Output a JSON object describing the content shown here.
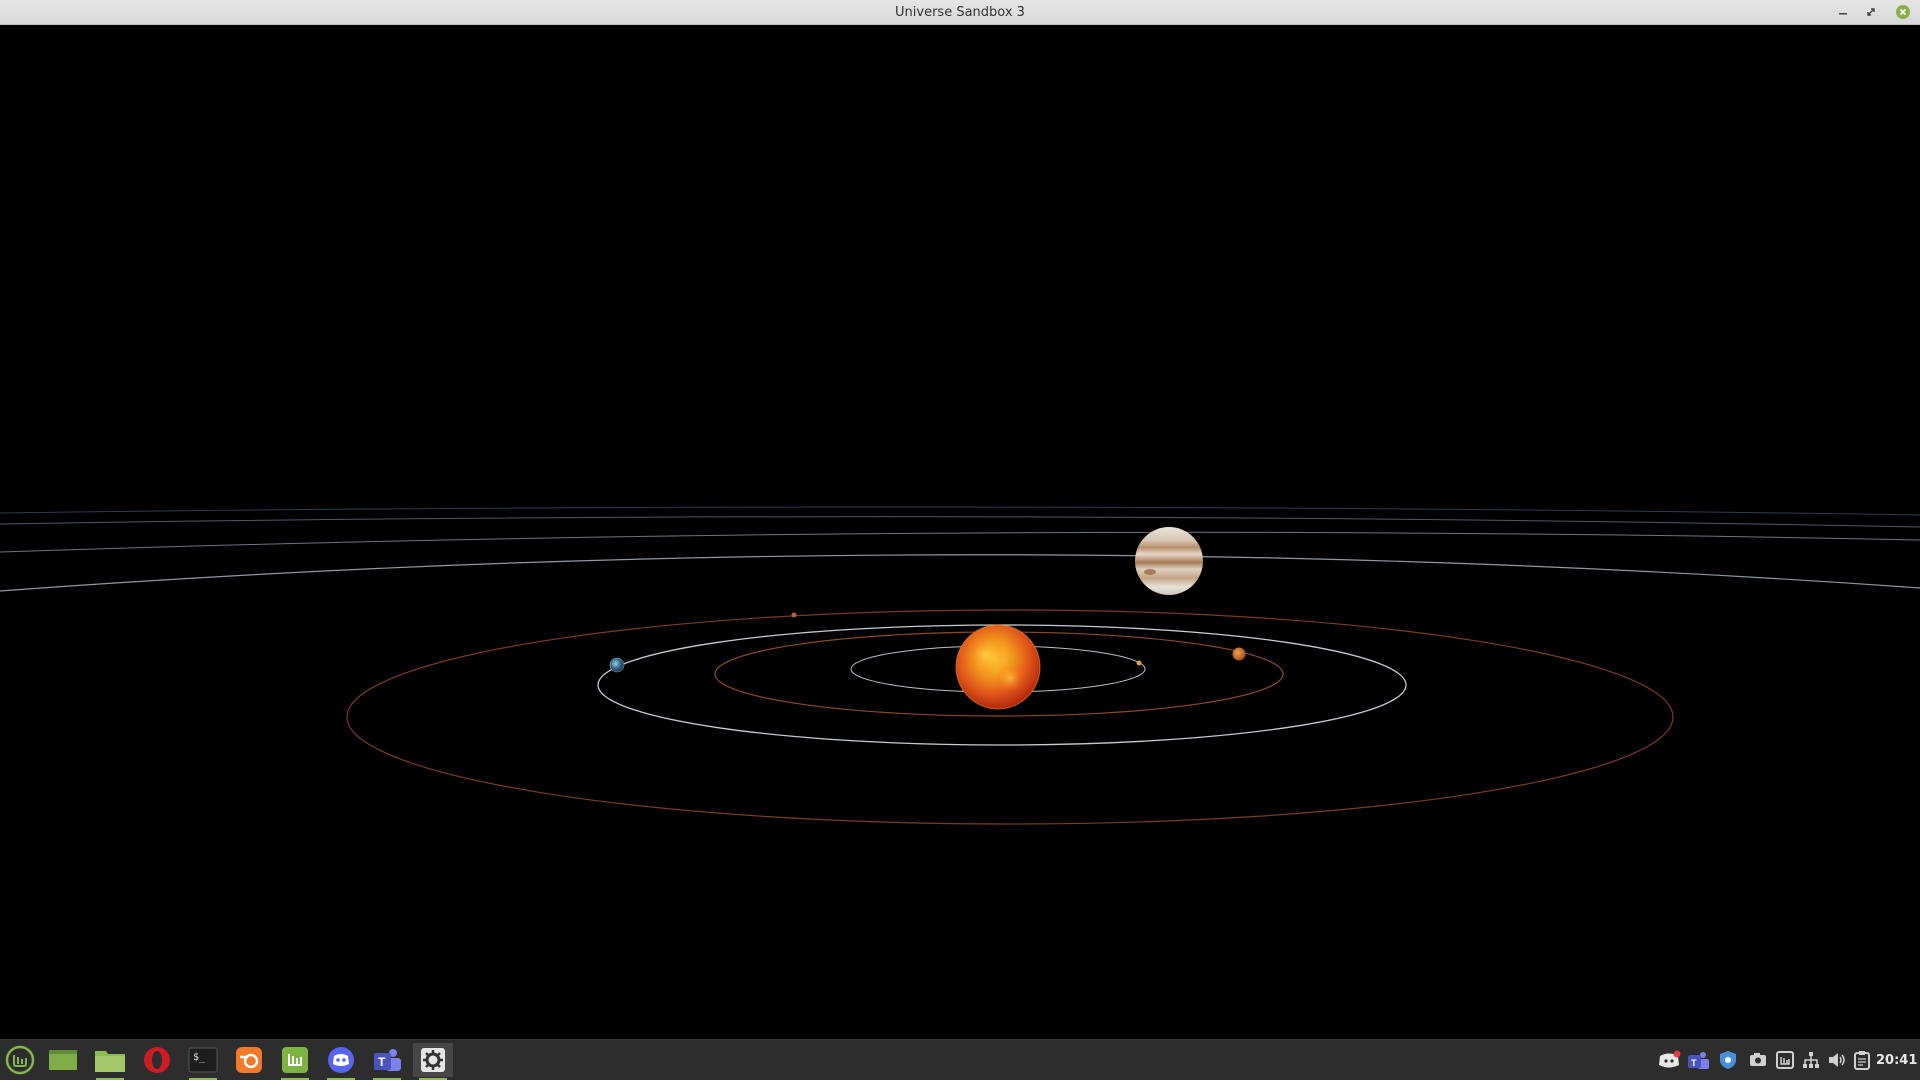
{
  "window": {
    "title": "Universe Sandbox 3",
    "controls": {
      "minimize_icon": "minimize-icon",
      "maximize_icon": "maximize-icon",
      "close_icon": "close-icon"
    }
  },
  "scene": {
    "background": "#000000",
    "bodies": [
      {
        "name": "sun",
        "color": "#e8561a"
      },
      {
        "name": "jupiter",
        "color": "#d9c3a6"
      },
      {
        "name": "earth",
        "color": "#4f7fa8"
      },
      {
        "name": "mars",
        "color": "#c96b2e"
      },
      {
        "name": "venus",
        "color": "#d7a55a"
      },
      {
        "name": "mercury",
        "color": "#b35c3a"
      }
    ],
    "orbit_colors": {
      "rocky": "#8a4a2a",
      "earth": "#b8c4cc",
      "outer": "#7e8a96"
    }
  },
  "taskbar": {
    "apps": [
      {
        "name": "mint-menu-icon",
        "color": "#86b34b"
      },
      {
        "name": "show-desktop-icon",
        "color": "#7fae49"
      },
      {
        "name": "files-icon",
        "color": "#8fbc4f"
      },
      {
        "name": "opera-icon",
        "color": "#cc1b22"
      },
      {
        "name": "terminal-icon",
        "color": "#1e1e1e"
      },
      {
        "name": "blender-icon",
        "color": "#f5792a"
      },
      {
        "name": "mintupdate-icon",
        "color": "#7cb342"
      },
      {
        "name": "discord-icon",
        "color": "#5865f2"
      },
      {
        "name": "teams-icon",
        "color": "#5b5fc7"
      },
      {
        "name": "settings-icon",
        "color": "#dddddd"
      }
    ],
    "tray": [
      "discord-tray-icon",
      "teams-tray-icon",
      "shield-icon",
      "screenshot-icon",
      "update-icon",
      "network-icon",
      "volume-icon",
      "clipboard-icon"
    ],
    "clock": "20:41"
  }
}
